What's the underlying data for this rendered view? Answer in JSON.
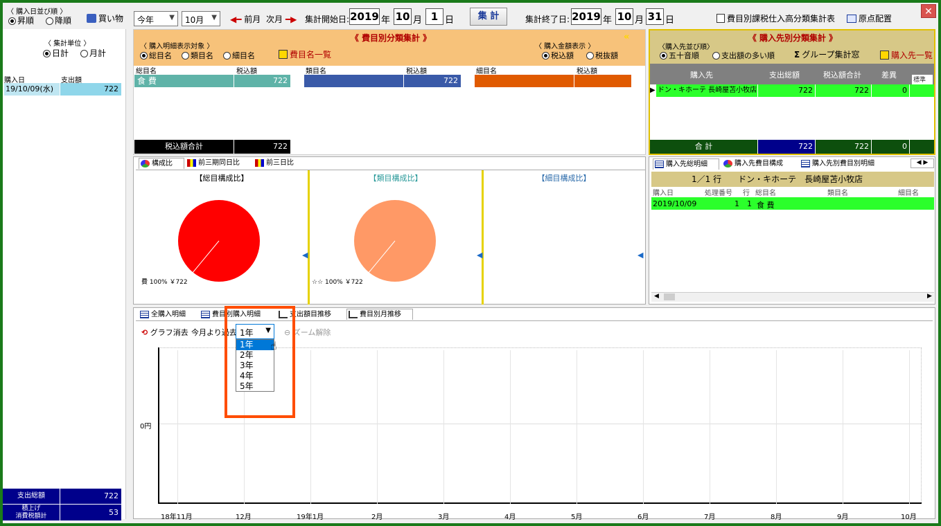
{
  "toolbar": {
    "sort_group_label": "〈 購入日並び順 〉",
    "sort_asc": "昇順",
    "sort_desc": "降順",
    "shopping_label": "買い物",
    "year_select": "今年",
    "month_select": "10月",
    "prev_month": "前月",
    "next_month": "次月",
    "start_label": "集計開始日:",
    "start_year": "2019",
    "year_unit": "年",
    "start_month": "10",
    "month_unit": "月",
    "start_day": "1",
    "day_unit": "日",
    "aggregate_button": "集 計",
    "end_label": "集計終了日:",
    "end_year": "2019",
    "end_month": "10",
    "end_day": "31",
    "report_button": "費目別課税仕入高分類集計表",
    "layout_button": "原点配置"
  },
  "left": {
    "unit_label": "〈 集計単位 〉",
    "daily": "日計",
    "monthly": "月計",
    "col_date": "購入日",
    "col_amount": "支出額",
    "rows": [
      {
        "date": "19/10/09(水)",
        "amount": "722"
      }
    ],
    "total_label": "支出総額",
    "total_value": "722",
    "tax_label_1": "積上げ",
    "tax_label_2": "消費税額計",
    "tax_value": "53"
  },
  "category_panel": {
    "title": "《 費目別分類集計 》",
    "target_label": "〈 購入明細表示対象 〉",
    "opt_total": "総目名",
    "opt_type": "類目名",
    "opt_detail": "細目名",
    "list_link": "費目名一覧",
    "amount_label": "〈 購入金額表示 〉",
    "opt_incl": "税込額",
    "opt_excl": "税抜額",
    "col1_name": "総目名",
    "col1_amt": "税込額",
    "col2_name": "類目名",
    "col2_amt": "税込額",
    "col3_name": "細目名",
    "col3_amt": "税込額",
    "row1_name": "食 費",
    "row1_amt": "722",
    "row2_amt": "722",
    "total_label": "税込額合計",
    "total_value": "722"
  },
  "store_panel": {
    "title": "《 購入先別分類集計 》",
    "sort_label": "〈購入先並び順〉",
    "opt_kana": "五十音順",
    "opt_amount": "支出額の多い順",
    "group_button": "グループ集計窓",
    "list_link": "購入先一覧",
    "col_store": "購入先",
    "col_total": "支出総額",
    "col_tax_total": "税込額合計",
    "col_diff": "差異",
    "col_extra": "標準",
    "row_store": "ドン・キホーテ 長崎屋苫小牧店",
    "row_total": "722",
    "row_tax_total": "722",
    "row_diff": "0",
    "sum_label": "合 計",
    "sum_total": "722",
    "sum_tax_total": "722",
    "sum_diff": "0"
  },
  "detail_panel": {
    "tab1": "購入先総明細",
    "tab2": "購入先費目構成",
    "tab3": "購入先別費目別明細",
    "header": "1／1 行　　ドン・キホーテ　長崎屋苫小牧店",
    "col_date": "購入日",
    "col_no": "処理番号",
    "col_row": "行",
    "col_total": "総目名",
    "col_type": "類目名",
    "col_detail": "細目名",
    "row_date": "2019/10/09",
    "row_no": "1",
    "row_row": "1",
    "row_total": "食 費"
  },
  "pie_panel": {
    "tab1": "構成比",
    "tab2": "前三期同日比",
    "tab3": "前三日比",
    "title1": "【総目構成比】",
    "title2": "【類目構成比】",
    "title3": "【細目構成比】",
    "label1": "費 100% ￥722",
    "label2": "☆☆ 100% ￥722",
    "color1": "#ff0000",
    "color2": "#ff9966"
  },
  "bottom": {
    "tab1": "全購入明細",
    "tab2": "費目別購入明細",
    "tab3": "支出額目推移",
    "tab4": "費目別月推移",
    "clear_graph": "グラフ消去",
    "period_label": "今月より過去",
    "period_value": "1年",
    "zoom_reset": "ズーム解除",
    "dropdown_options": [
      "1年",
      "2年",
      "3年",
      "4年",
      "5年"
    ]
  },
  "chart_data": {
    "type": "line",
    "title": "",
    "xlabel": "",
    "ylabel": "",
    "categories": [
      "18年11月",
      "12月",
      "19年1月",
      "2月",
      "3月",
      "4月",
      "5月",
      "6月",
      "7月",
      "8月",
      "9月",
      "10月"
    ],
    "y_tick": "0円",
    "series": []
  }
}
